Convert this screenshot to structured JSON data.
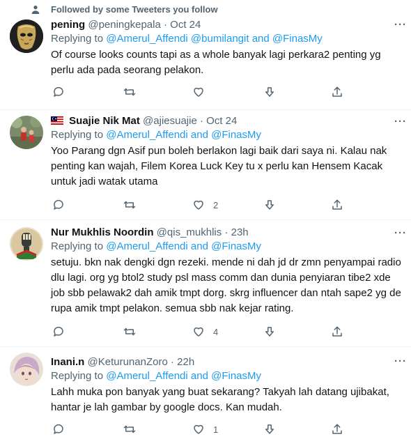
{
  "social_context": "Followed by some Tweeters you follow",
  "tweets": [
    {
      "name": "pening",
      "handle": "@peningkepala",
      "time": "Oct 24",
      "replying_label": "Replying to",
      "mentions": [
        "@Amerul_Affendi",
        "@bumilangit",
        "@FinasMy"
      ],
      "text": "Of course looks counts tapi as a whole banyak lagi perkara2 penting yg perlu ada pada seorang pelakon.",
      "likes": ""
    },
    {
      "name": "Suajie Nik Mat",
      "handle": "@ajiesuajie",
      "time": "Oct 24",
      "replying_label": "Replying to",
      "mentions": [
        "@Amerul_Affendi",
        "@FinasMy"
      ],
      "text": "Yoo Parang dgn Asif pun boleh berlakon lagi baik dari saya ni. Kalau nak penting kan wajah, Filem Korea Luck Key tu x perlu kan Hensem Kacak untuk jadi watak utama",
      "likes": "2"
    },
    {
      "name": "Nur Mukhlis Noordin",
      "handle": "@qis_mukhlis",
      "time": "23h",
      "replying_label": "Replying to",
      "mentions": [
        "@Amerul_Affendi",
        "@FinasMy"
      ],
      "text": "setuju. bkn nak dengki dgn rezeki. mende ni dah jd dr zmn penyampai radio dlu lagi. org yg btol2 study psl mass comm dan dunia penyiaran tibe2 xde job sbb pelawak2 dah amik tmpt dorg. skrg influencer dan ntah sape2 yg de rupa amik tmpt pelakon. semua sbb nak kejar rating.",
      "likes": "4"
    },
    {
      "name": "Inani.n",
      "handle": "@KeturunanZoro",
      "time": "22h",
      "replying_label": "Replying to",
      "mentions": [
        "@Amerul_Affendi",
        "@FinasMy"
      ],
      "text": "Lahh muka pon banyak yang buat sekarang? Takyah lah datang ujibakat, hantar je lah gambar by google docs. Kan mudah.",
      "likes": "1"
    }
  ],
  "words": {
    "and": "and",
    "dot": "·",
    "more": "···"
  },
  "colors": {
    "accent": "#1d9bf0",
    "muted": "#536471",
    "text": "#0f1419",
    "divider": "#eff3f4"
  }
}
